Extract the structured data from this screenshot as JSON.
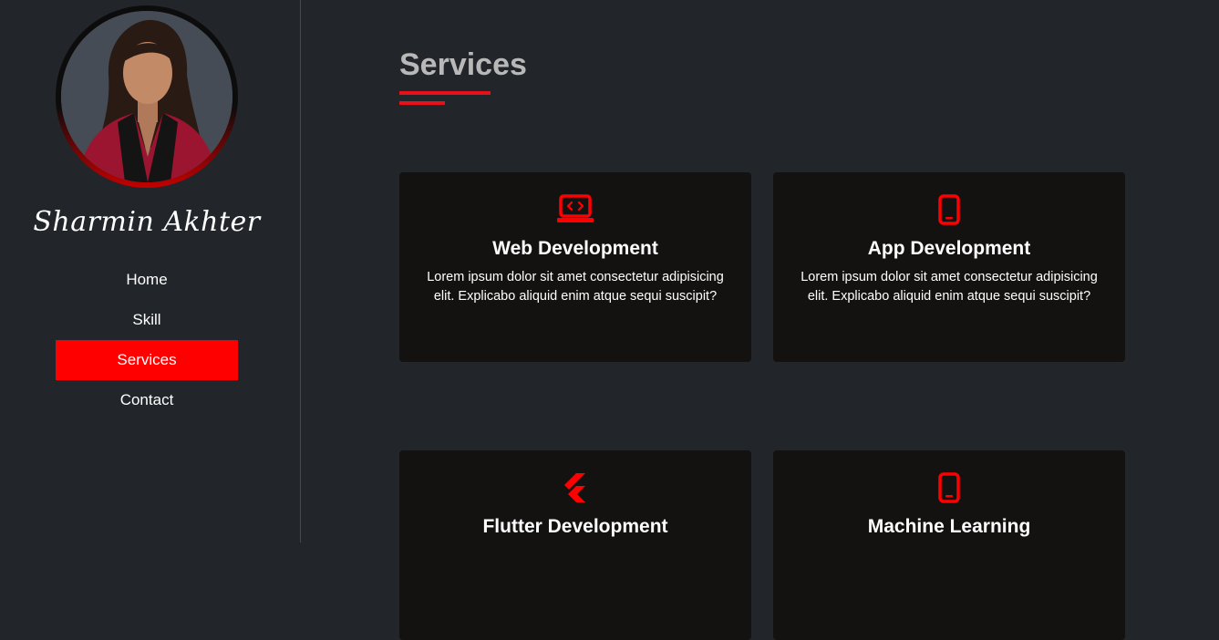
{
  "sidebar": {
    "name": "Sharmin Akhter",
    "nav": [
      {
        "label": "Home",
        "active": false
      },
      {
        "label": "Skill",
        "active": false
      },
      {
        "label": "Services",
        "active": true
      },
      {
        "label": "Contact",
        "active": false
      }
    ]
  },
  "main": {
    "title": "Services",
    "cards": [
      {
        "icon": "laptop-code-icon",
        "title": "Web Development",
        "text": "Lorem ipsum dolor sit amet consectetur adipisicing elit. Explicabo aliquid enim atque sequi suscipit?"
      },
      {
        "icon": "mobile-phone-icon",
        "title": "App Development",
        "text": "Lorem ipsum dolor sit amet consectetur adipisicing elit. Explicabo aliquid enim atque sequi suscipit?"
      },
      {
        "icon": "flutter-icon",
        "title": "Flutter Development",
        "text": ""
      },
      {
        "icon": "mobile-phone-icon",
        "title": "Machine Learning",
        "text": ""
      }
    ]
  },
  "colors": {
    "accent": "#ff0000",
    "background": "#22252a",
    "card": "#141111",
    "title": "#b8b8b8"
  }
}
